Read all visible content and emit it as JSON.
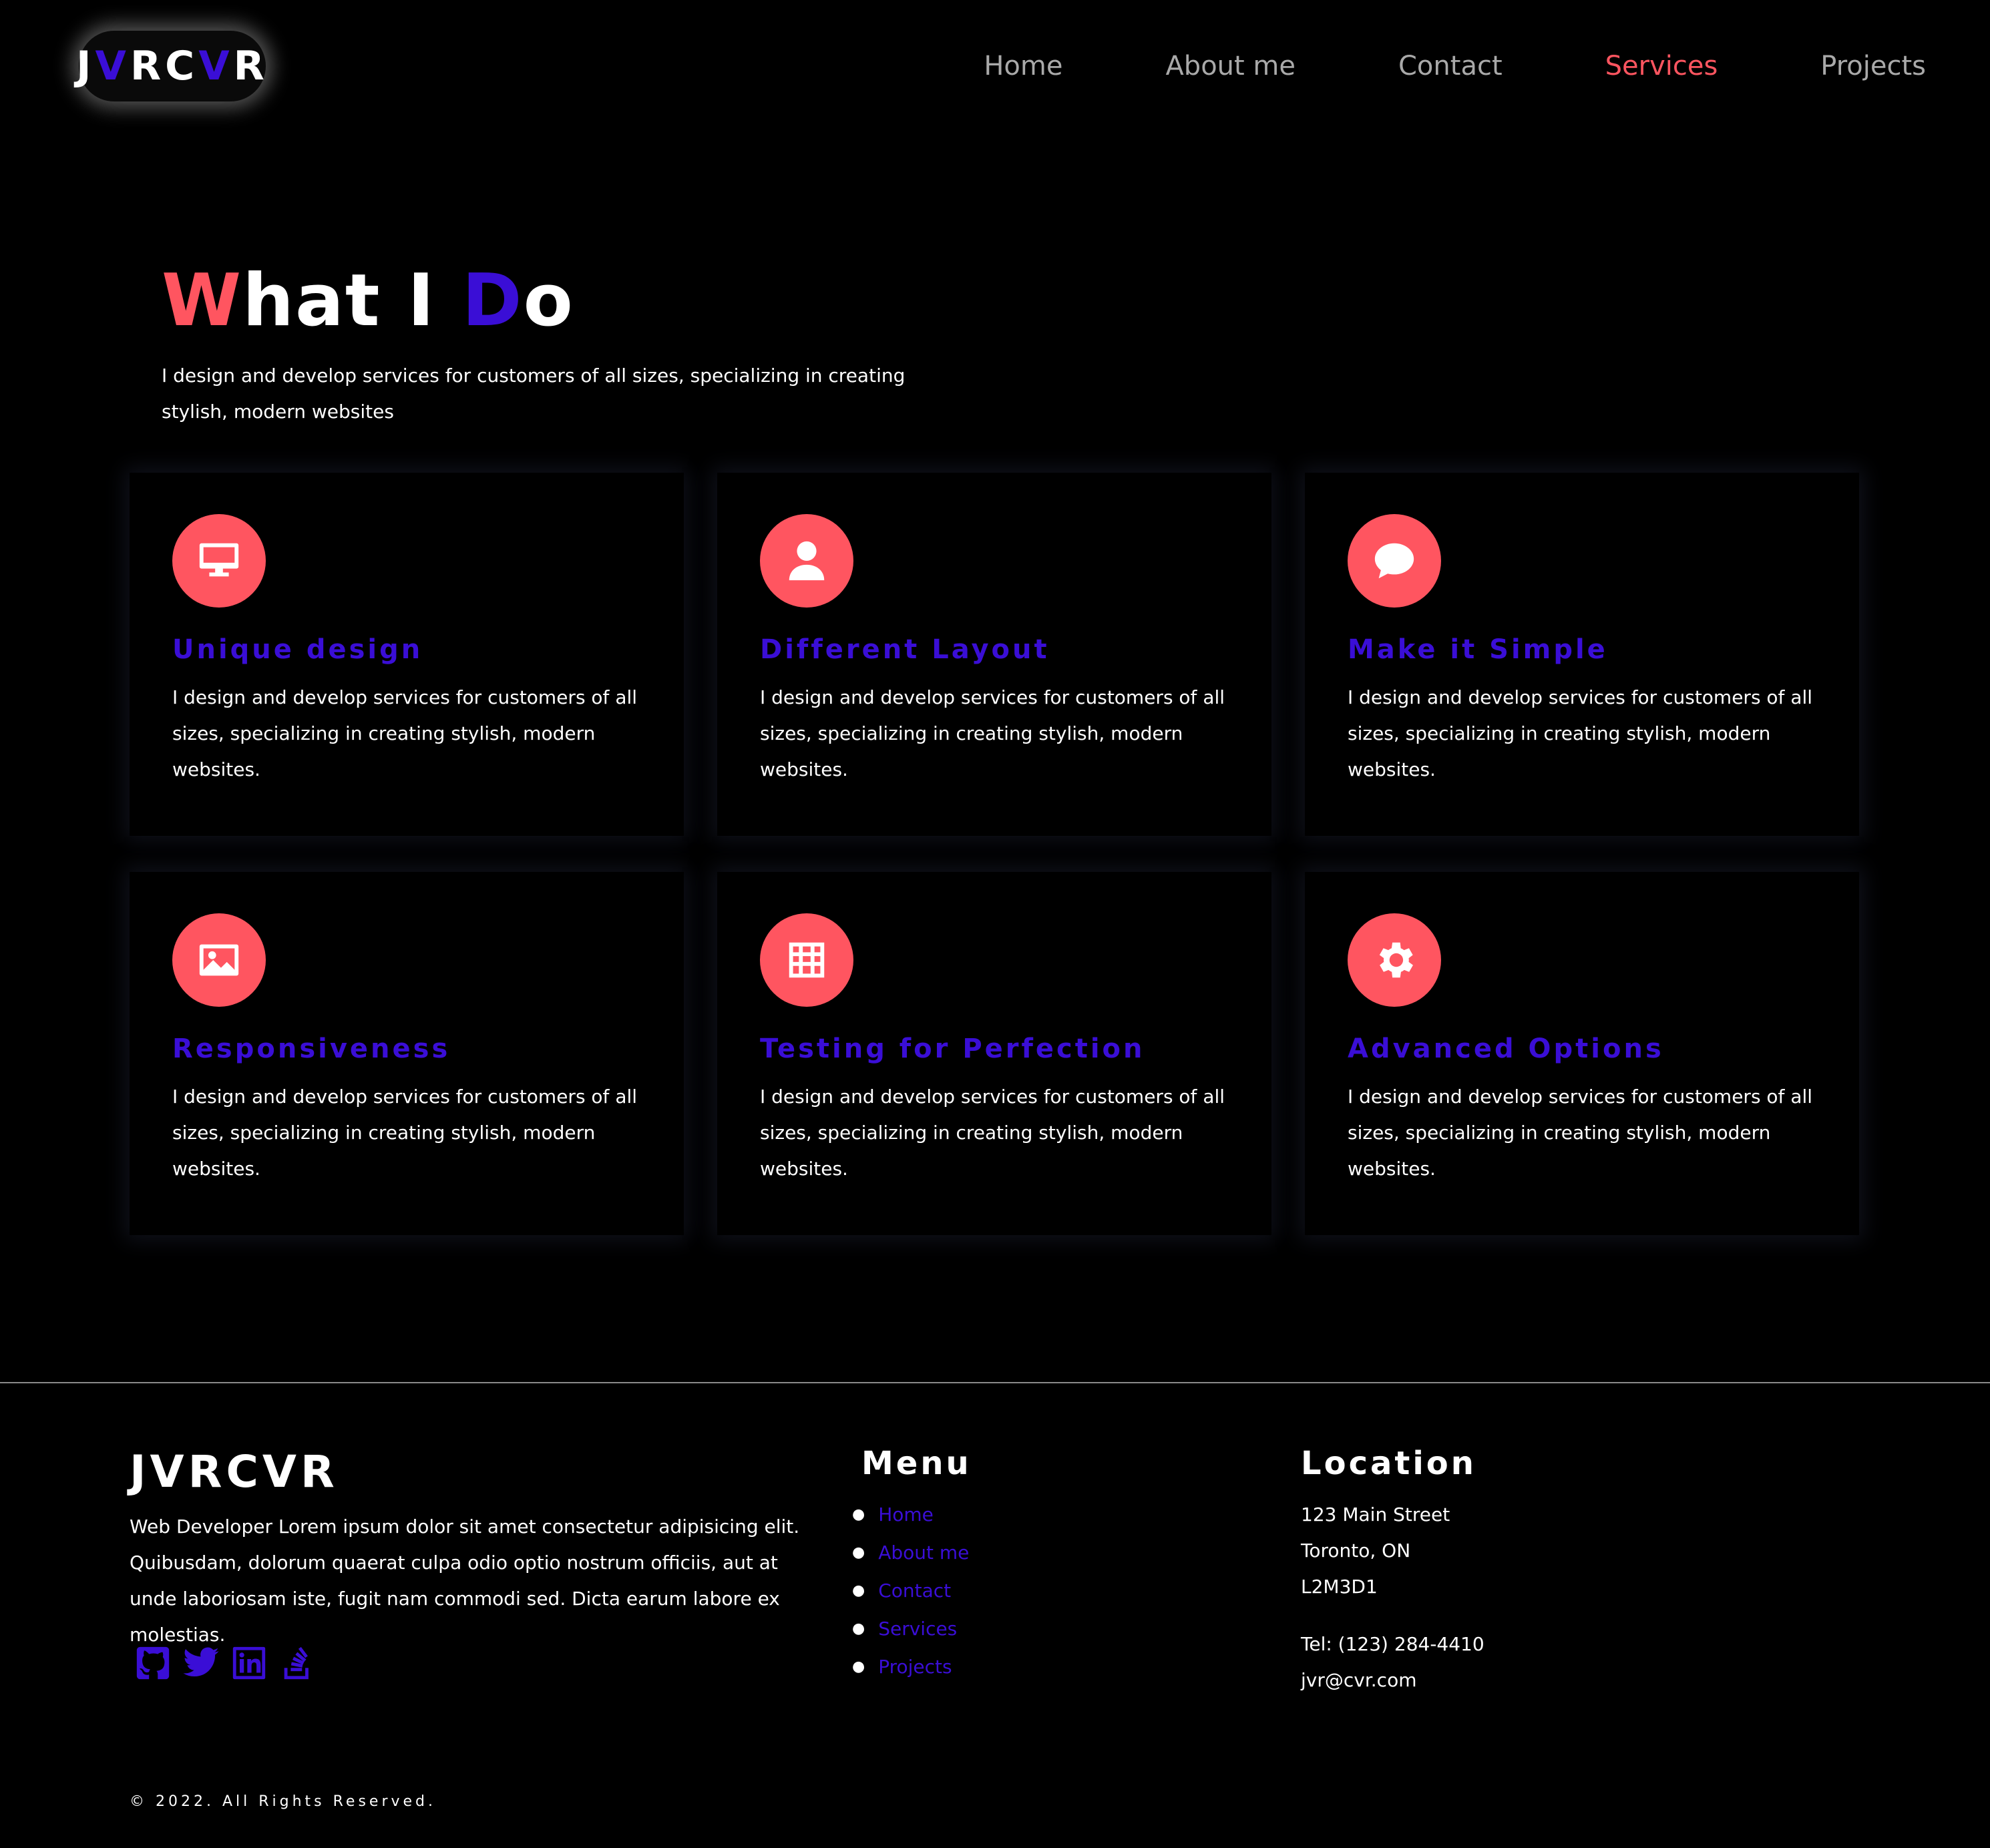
{
  "brand": {
    "logo_letters": [
      "J",
      "V",
      "R",
      "C",
      "V",
      "R"
    ],
    "accent_red": "#ff5560",
    "accent_purple": "#3a0ed6"
  },
  "nav": {
    "items": [
      {
        "label": "Home"
      },
      {
        "label": "About me"
      },
      {
        "label": "Contact"
      },
      {
        "label": "Services",
        "active": true
      },
      {
        "label": "Projects"
      }
    ]
  },
  "hero": {
    "title_parts": [
      "W",
      "hat I ",
      "D",
      "o"
    ],
    "subtitle": "I design and develop services for customers of all sizes, specializing in creating stylish, modern websites"
  },
  "services": [
    {
      "icon": "monitor-icon",
      "title": "Unique design",
      "text": "I design and develop services for customers of all sizes, specializing in creating stylish, modern websites."
    },
    {
      "icon": "user-icon",
      "title": "Different Layout",
      "text": "I design and develop services for customers of all sizes, specializing in creating stylish, modern websites."
    },
    {
      "icon": "chat-bubble-icon",
      "title": "Make it Simple",
      "text": "I design and develop services for customers of all sizes, specializing in creating stylish, modern websites."
    },
    {
      "icon": "image-icon",
      "title": "Responsiveness",
      "text": "I design and develop services for customers of all sizes, specializing in creating stylish, modern websites."
    },
    {
      "icon": "table-icon",
      "title": "Testing for Perfection",
      "text": "I design and develop services for customers of all sizes, specializing in creating stylish, modern websites."
    },
    {
      "icon": "gear-icon",
      "title": "Advanced Options",
      "text": "I design and develop services for customers of all sizes, specializing in creating stylish, modern websites."
    }
  ],
  "footer": {
    "brand": "JVRCVR",
    "description": "Web Developer Lorem ipsum dolor sit amet consectetur adipisicing elit. Quibusdam, dolorum quaerat culpa odio optio nostrum officiis, aut at unde laboriosam iste, fugit nam commodi sed. Dicta earum labore ex molestias.",
    "socials": [
      "github-icon",
      "twitter-icon",
      "linkedin-icon",
      "stackoverflow-icon"
    ],
    "menu_title": "Menu",
    "menu": [
      "Home",
      "About me",
      "Contact",
      "Services",
      "Projects"
    ],
    "location_title": "Location",
    "address": [
      "123 Main Street",
      "Toronto, ON",
      "L2M3D1"
    ],
    "phone": "Tel: (123) 284-4410",
    "email": "jvr@cvr.com",
    "copyright": "© 2022. All Rights Reserved."
  }
}
